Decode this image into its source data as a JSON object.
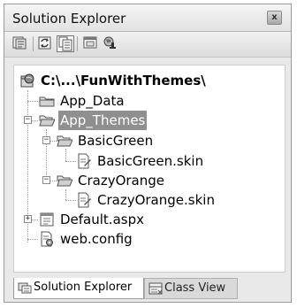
{
  "panel": {
    "title": "Solution Explorer",
    "close_glyph": "x"
  },
  "toolbar": {
    "buttons": [
      {
        "name": "properties-icon"
      },
      {
        "name": "refresh-icon"
      },
      {
        "name": "show-all-files-icon"
      },
      {
        "name": "view-designer-icon"
      },
      {
        "name": "copy-website-icon"
      }
    ]
  },
  "tree": {
    "root": {
      "label": "C:\\...\\FunWithThemes\\",
      "icon": "website-icon"
    },
    "items": [
      {
        "label": "App_Data",
        "icon": "folder-icon"
      },
      {
        "label": "App_Themes",
        "icon": "folder-open-icon",
        "selected": true,
        "expander": "−"
      },
      {
        "label": "BasicGreen",
        "icon": "folder-open-icon",
        "expander": "−"
      },
      {
        "label": "BasicGreen.skin",
        "icon": "skin-file-icon"
      },
      {
        "label": "CrazyOrange",
        "icon": "folder-open-icon",
        "expander": "−"
      },
      {
        "label": "CrazyOrange.skin",
        "icon": "skin-file-icon"
      },
      {
        "label": "Default.aspx",
        "icon": "aspx-file-icon",
        "expander": "+"
      },
      {
        "label": "web.config",
        "icon": "config-file-icon"
      }
    ]
  },
  "tabs": [
    {
      "label": "Solution Explorer",
      "icon": "solution-explorer-icon",
      "active": true
    },
    {
      "label": "Class View",
      "icon": "class-view-icon",
      "active": false
    }
  ]
}
